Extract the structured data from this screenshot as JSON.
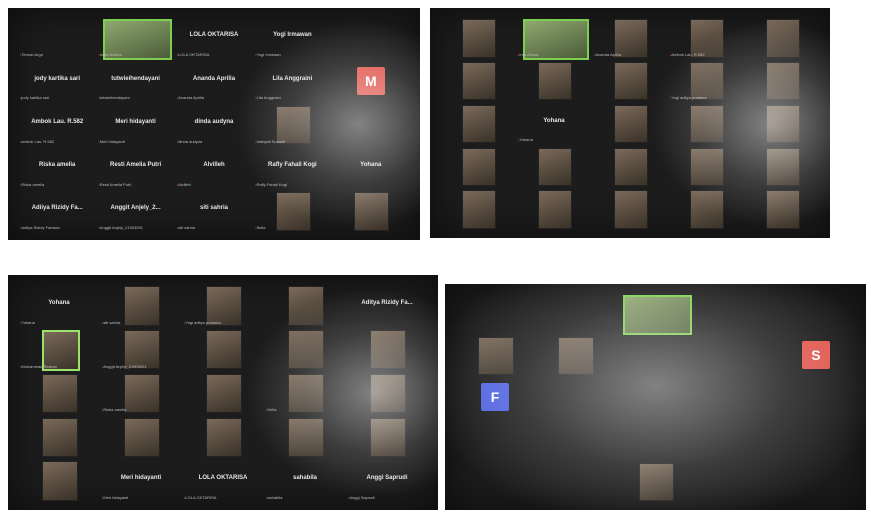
{
  "colors": {
    "panel_bg": "#1c1c1c",
    "active_speaker_border": "#7ccf4f",
    "mute_icon": "#ff4040",
    "avatar_m": "#e0584f",
    "avatar_s": "#e0584f",
    "avatar_f": "#4f63e0"
  },
  "panel1": {
    "tiles": [
      {
        "name": "",
        "sub": "Ternad Argo"
      },
      {
        "name": "",
        "sub": "Intan Anisha",
        "video": "green"
      },
      {
        "name": "LOLA OKTARISA",
        "sub": "LOLA OKTARISA"
      },
      {
        "name": "Yogi Irmawan",
        "sub": "Yogi Irmawan"
      },
      {
        "name": "",
        "sub": ""
      },
      {
        "name": "jody kartika sari",
        "sub": "jody kartika sari"
      },
      {
        "name": "tutwieihendayani",
        "sub": "tutwieihendayani"
      },
      {
        "name": "Ananda Aprilia",
        "sub": "Ananda Aprilia"
      },
      {
        "name": "Lila Anggraini",
        "sub": "Lila Anggraini"
      },
      {
        "name": "",
        "sub": "",
        "avatar": "M"
      },
      {
        "name": "Ambok Lau. R.582",
        "sub": "ambok Lau. R.582"
      },
      {
        "name": "Meri hidayanti",
        "sub": "Meri hidayanti"
      },
      {
        "name": "dinda audyna",
        "sub": "dinda audyna"
      },
      {
        "name": "",
        "sub": "Indriyati Susanti",
        "video": "plain"
      },
      {
        "name": "",
        "sub": ""
      },
      {
        "name": "Riska amelia",
        "sub": "Riska amelia"
      },
      {
        "name": "Resti Amelia Putri",
        "sub": "Resti Amelia Putri"
      },
      {
        "name": "Alvilleh",
        "sub": "Alvilleh"
      },
      {
        "name": "Rafly Fahali Kogi",
        "sub": "Rafly Fahali Kogi"
      },
      {
        "name": "Yohana",
        "sub": ""
      },
      {
        "name": "Adiiya Rizidy Fa...",
        "sub": "Aditya Rizidy Fanwan"
      },
      {
        "name": "Anggit Anjely_2...",
        "sub": "Anggit Anjely_21903091"
      },
      {
        "name": "siti sahria",
        "sub": "siti sahria"
      },
      {
        "name": "",
        "sub": "Sella",
        "video": "plain"
      },
      {
        "name": "",
        "sub": "",
        "video": "plain"
      }
    ]
  },
  "panel2": {
    "tiles": [
      {
        "name": "",
        "sub": "",
        "video": "plain"
      },
      {
        "name": "",
        "sub": "Inta Arisna",
        "video": "green"
      },
      {
        "name": "",
        "sub": "Ananda Aprilia",
        "video": "plain"
      },
      {
        "name": "",
        "sub": "Ambok Lau. R.582",
        "video": "plain"
      },
      {
        "name": "",
        "sub": "",
        "video": "plain"
      },
      {
        "name": "",
        "sub": "",
        "video": "plain"
      },
      {
        "name": "",
        "sub": "",
        "video": "plain"
      },
      {
        "name": "",
        "sub": "",
        "video": "plain"
      },
      {
        "name": "",
        "sub": "Yogi aditya pratama",
        "video": "plain"
      },
      {
        "name": "",
        "sub": "",
        "video": "plain"
      },
      {
        "name": "",
        "sub": "",
        "video": "plain"
      },
      {
        "name": "Yohana",
        "sub": "Yohana"
      },
      {
        "name": "",
        "sub": "",
        "video": "plain"
      },
      {
        "name": "",
        "sub": "",
        "video": "plain"
      },
      {
        "name": "",
        "sub": "",
        "video": "plain"
      },
      {
        "name": "",
        "sub": "",
        "video": "plain"
      },
      {
        "name": "",
        "sub": "",
        "video": "plain"
      },
      {
        "name": "",
        "sub": "",
        "video": "plain"
      },
      {
        "name": "",
        "sub": "",
        "video": "plain"
      },
      {
        "name": "",
        "sub": "",
        "video": "plain"
      },
      {
        "name": "",
        "sub": "",
        "video": "plain"
      },
      {
        "name": "",
        "sub": "",
        "video": "plain"
      },
      {
        "name": "",
        "sub": "",
        "video": "plain"
      },
      {
        "name": "",
        "sub": "",
        "video": "plain"
      },
      {
        "name": "",
        "sub": "",
        "video": "plain"
      }
    ]
  },
  "panel3": {
    "tiles": [
      {
        "name": "Yohana",
        "sub": "Yohana"
      },
      {
        "name": "",
        "sub": "siti sahria",
        "video": "plain"
      },
      {
        "name": "",
        "sub": "Yogi aditya pratama",
        "video": "plain"
      },
      {
        "name": "",
        "sub": "",
        "video": "plain"
      },
      {
        "name": "Aditya Rizidy Fa...",
        "sub": ""
      },
      {
        "name": "",
        "sub": "Muhammad Ridwan",
        "video": "active"
      },
      {
        "name": "",
        "sub": "Anggit Anjely_21903091",
        "video": "plain"
      },
      {
        "name": "",
        "sub": "",
        "video": "plain"
      },
      {
        "name": "",
        "sub": "",
        "video": "plain"
      },
      {
        "name": "",
        "sub": "",
        "video": "plain"
      },
      {
        "name": "",
        "sub": "",
        "video": "plain"
      },
      {
        "name": "",
        "sub": "Riska amelia",
        "video": "plain"
      },
      {
        "name": "",
        "sub": "",
        "video": "plain"
      },
      {
        "name": "",
        "sub": "Sella",
        "video": "plain"
      },
      {
        "name": "",
        "sub": "",
        "video": "plain"
      },
      {
        "name": "",
        "sub": "",
        "video": "plain"
      },
      {
        "name": "",
        "sub": "",
        "video": "plain"
      },
      {
        "name": "",
        "sub": "",
        "video": "plain"
      },
      {
        "name": "",
        "sub": "",
        "video": "plain"
      },
      {
        "name": "",
        "sub": "",
        "video": "plain"
      },
      {
        "name": "",
        "sub": "",
        "video": "plain"
      },
      {
        "name": "Meri hidayanti",
        "sub": "Meri hidayanti"
      },
      {
        "name": "LOLA OKTARISA",
        "sub": "LOLA OKTARISA"
      },
      {
        "name": "sahabila",
        "sub": "sahabila"
      },
      {
        "name": "Anggi Saprudi",
        "sub": "Anggi Saprudi"
      }
    ]
  },
  "panel4": {
    "tiles": [
      {
        "name": "",
        "sub": ""
      },
      {
        "name": "",
        "sub": ""
      },
      {
        "name": "",
        "sub": "",
        "video": "green"
      },
      {
        "name": "",
        "sub": ""
      },
      {
        "name": "",
        "sub": ""
      },
      {
        "name": "",
        "sub": "",
        "video": "plain"
      },
      {
        "name": "",
        "sub": "",
        "video": "plain"
      },
      {
        "name": "",
        "sub": ""
      },
      {
        "name": "",
        "sub": ""
      },
      {
        "name": "",
        "sub": "",
        "avatar": "S"
      },
      {
        "name": "",
        "sub": "",
        "avatar": "F"
      },
      {
        "name": "",
        "sub": ""
      },
      {
        "name": "",
        "sub": ""
      },
      {
        "name": "",
        "sub": ""
      },
      {
        "name": "",
        "sub": ""
      },
      {
        "name": "",
        "sub": ""
      },
      {
        "name": "",
        "sub": ""
      },
      {
        "name": "",
        "sub": ""
      },
      {
        "name": "",
        "sub": ""
      },
      {
        "name": "",
        "sub": ""
      },
      {
        "name": "",
        "sub": ""
      },
      {
        "name": "",
        "sub": ""
      },
      {
        "name": "",
        "sub": "",
        "video": "plain"
      },
      {
        "name": "",
        "sub": ""
      },
      {
        "name": "",
        "sub": ""
      }
    ]
  }
}
